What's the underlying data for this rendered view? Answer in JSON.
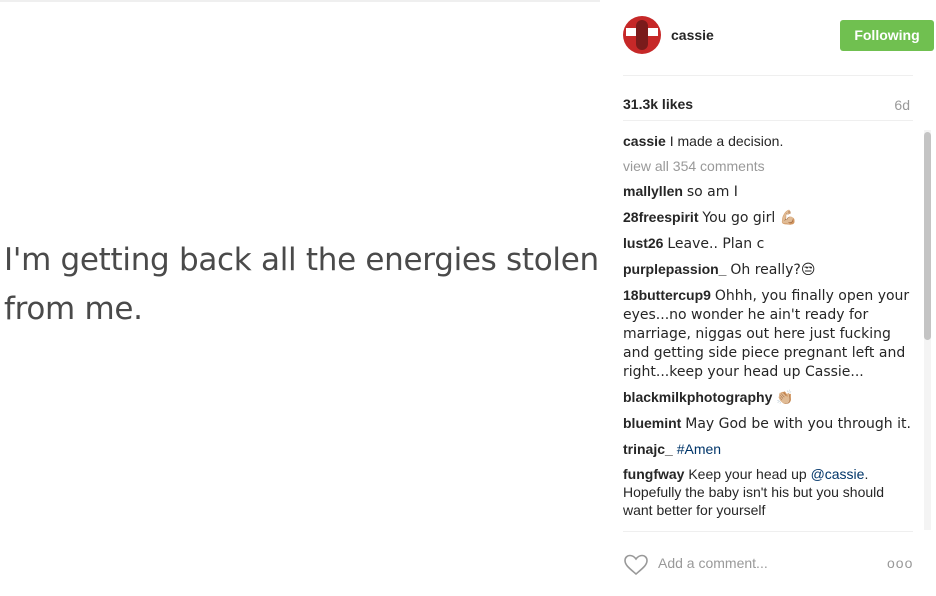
{
  "post": {
    "image_text": "I'm getting back all the energies stolen from me.",
    "author": "cassie",
    "follow_label": "Following",
    "likes": "31.3k likes",
    "age": "6d",
    "caption": {
      "user": "cassie",
      "text": "I made a decision."
    },
    "view_all": "view all 354 comments",
    "comments": [
      {
        "user": "mallyllen",
        "text": "so am I"
      },
      {
        "user": "28freespirit",
        "text": "You go girl 💪🏼"
      },
      {
        "user": "lust26",
        "text": "Leave.. Plan c"
      },
      {
        "user": "purplepassion_",
        "text": "Oh really?😒"
      },
      {
        "user": "18buttercup9",
        "text": "Ohhh, you finally open your eyes...no wonder he ain't ready for marriage, niggas out here just fucking and getting side piece pregnant left and right...keep your head up Cassie..."
      },
      {
        "user": "blackmilkphotography",
        "text": "👏🏼"
      },
      {
        "user": "bluemint",
        "text": "May God be with you through it."
      },
      {
        "user": "trinajc_",
        "text": "",
        "tag": "#Amen"
      },
      {
        "user": "fungfway",
        "text_before": "Keep your head up ",
        "mention": "@cassie",
        "text_after": ". Hopefully the baby isn't his but you should want better for yourself"
      }
    ],
    "add_comment_placeholder": "Add a comment...",
    "more_label": "ooo"
  },
  "colors": {
    "follow_green": "#70c050",
    "muted": "#999999",
    "link": "#003569"
  },
  "icons": [
    "heart-icon",
    "more-options-icon"
  ]
}
